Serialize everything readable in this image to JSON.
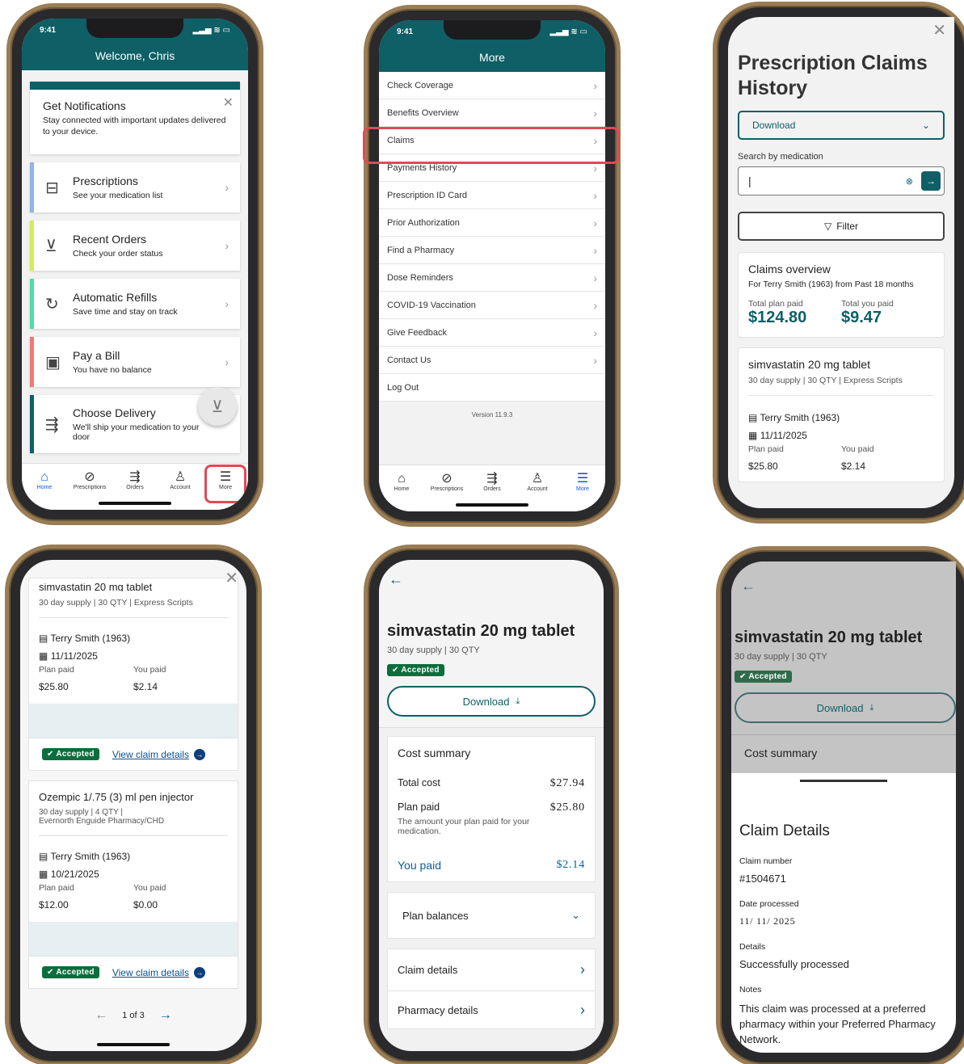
{
  "status": {
    "time": "9:41"
  },
  "tabs": {
    "home": "Home",
    "prescriptions": "Prescriptions",
    "orders": "Orders",
    "account": "Account",
    "more": "More"
  },
  "home": {
    "welcome": "Welcome, Chris",
    "notify": {
      "title": "Get Notifications",
      "text": "Stay connected with important updates delivered to your device."
    },
    "items": [
      {
        "title": "Prescriptions",
        "sub": "See your medication list",
        "color": "#8fb3ea"
      },
      {
        "title": "Recent Orders",
        "sub": "Check your order status",
        "color": "#d7ea5a"
      },
      {
        "title": "Automatic Refills",
        "sub": "Save time and stay on track",
        "color": "#4fdcaa"
      },
      {
        "title": "Pay a Bill",
        "sub": "You have no balance",
        "color": "#ef7a78"
      },
      {
        "title": "Choose Delivery",
        "sub": "We'll ship your medication to your door",
        "color": "#0e5f66"
      }
    ]
  },
  "more": {
    "title": "More",
    "items": [
      "Check Coverage",
      "Benefits Overview",
      "Claims",
      "Payments History",
      "Prescription ID Card",
      "Prior Authorization",
      "Find a Pharmacy",
      "Dose Reminders",
      "COVID-19 Vaccination",
      "Give Feedback",
      "Contact Us",
      "Log Out"
    ],
    "version": "Version 11.9.3"
  },
  "history": {
    "title": "Prescription Claims History",
    "download": "Download",
    "search_label": "Search by medication",
    "filter": "Filter",
    "overview_title": "Claims overview",
    "overview_for": "For",
    "overview_person": "Terry Smith (1963)",
    "overview_from": "from",
    "overview_period": "Past 18 months",
    "total_plan_label": "Total plan paid",
    "total_plan": "$124.80",
    "total_you_label": "Total you paid",
    "total_you": "$9.47"
  },
  "claims": [
    {
      "name": "simvastatin 20 mg tablet",
      "meta": "30 day supply | 30 QTY | Express Scripts",
      "meta2": "",
      "person": "Terry Smith (1963)",
      "date": "11/11/2025",
      "plan_label": "Plan paid",
      "plan": "$25.80",
      "you_label": "You paid",
      "you": "$2.14",
      "status": "Accepted",
      "link": "View claim details"
    },
    {
      "name": "Ozempic 1/.75 (3) ml pen injector",
      "meta": "30 day supply | 4 QTY |",
      "meta2": "Evernorth Enguide Pharmacy/CHD",
      "person": "Terry Smith (1963)",
      "date": "10/21/2025",
      "plan_label": "Plan paid",
      "plan": "$12.00",
      "you_label": "You paid",
      "you": "$0.00",
      "status": "Accepted",
      "link": "View claim details"
    }
  ],
  "pager": "1 of 3",
  "detail": {
    "title": "simvastatin 20 mg tablet",
    "sub": "30 day supply | 30 QTY",
    "status": "Accepted",
    "download": "Download",
    "cost_summary": "Cost summary",
    "total_label": "Total cost",
    "total": "$27.94",
    "plan_label": "Plan paid",
    "plan": "$25.80",
    "plan_note": "The amount your plan paid for your medication.",
    "you_label": "You paid",
    "you": "$2.14",
    "plan_balances": "Plan balances",
    "claim_details": "Claim details",
    "pharmacy_details": "Pharmacy details"
  },
  "claimsheet": {
    "title": "Claim Details",
    "number_label": "Claim number",
    "number": "#1504671",
    "date_label": "Date processed",
    "date": "11/ 11/ 2025",
    "details_label": "Details",
    "details": "Successfully processed",
    "notes_label": "Notes",
    "notes": "This claim was processed at a preferred pharmacy within your Preferred Pharmacy Network."
  }
}
